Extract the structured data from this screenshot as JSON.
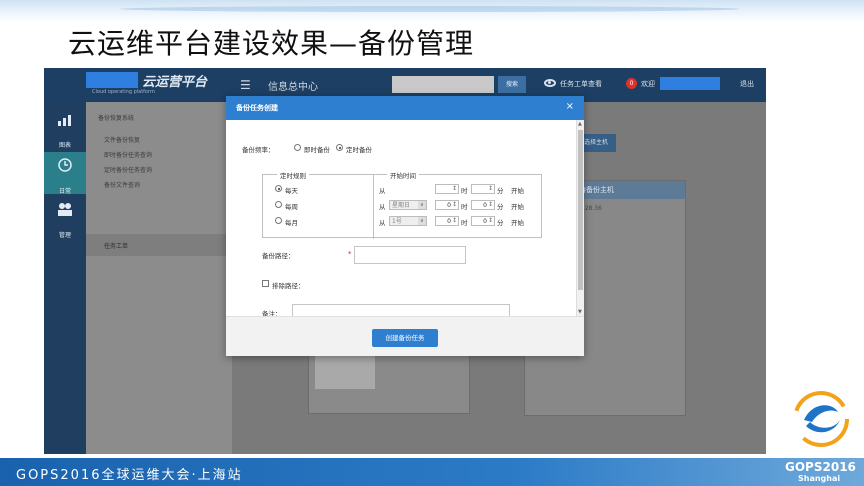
{
  "slide": {
    "title": "云运维平台建设效果—备份管理",
    "footer_text": "GOPS2016全球运维大会·上海站",
    "brand": "GOPS2016",
    "brand_city": "Shanghai"
  },
  "app": {
    "logo_name": "云运营平台",
    "logo_sub": "Cloud operating platform",
    "header_title": "信息总中心",
    "search_button": "搜索",
    "task_link": "任务工单查看",
    "notification_count": "0",
    "welcome": "欢迎",
    "logout": "退出"
  },
  "rail": {
    "items": [
      {
        "label": "图表",
        "icon": "chart-icon"
      },
      {
        "label": "日常",
        "icon": "clock-icon"
      },
      {
        "label": "管理",
        "icon": "users-icon"
      }
    ]
  },
  "subnav": {
    "section_title": "备份恢复系统",
    "items": [
      "文件备份恢复",
      "即时备份任务查询",
      "定时备份任务查询",
      "备份文件查询"
    ],
    "selected": "任务工单"
  },
  "background": {
    "select_host_button": "选择主机",
    "panel_title": "待备份主机",
    "panel_ip": ".128.36"
  },
  "modal": {
    "title": "备份任务创建",
    "close": "×",
    "backup_freq_label": "备份频率：",
    "freq_options": [
      "即时备份",
      "定时备份"
    ],
    "freq_selected": "定时备份",
    "rule_legend": "定时规则",
    "time_legend": "开始时间",
    "rules": [
      "每天",
      "每周",
      "每月"
    ],
    "rule_selected": "每天",
    "from_label": "从",
    "hour_label": "时",
    "minute_label": "分",
    "start_label": "开始",
    "weekday_select": "星期日",
    "monthday_select": "1号",
    "zero": "0",
    "backup_path_label": "备份路径：",
    "required_mark": "*",
    "exclude_path_label": "排除路径：",
    "note_label": "备注：",
    "create_button": "创建备份任务"
  }
}
